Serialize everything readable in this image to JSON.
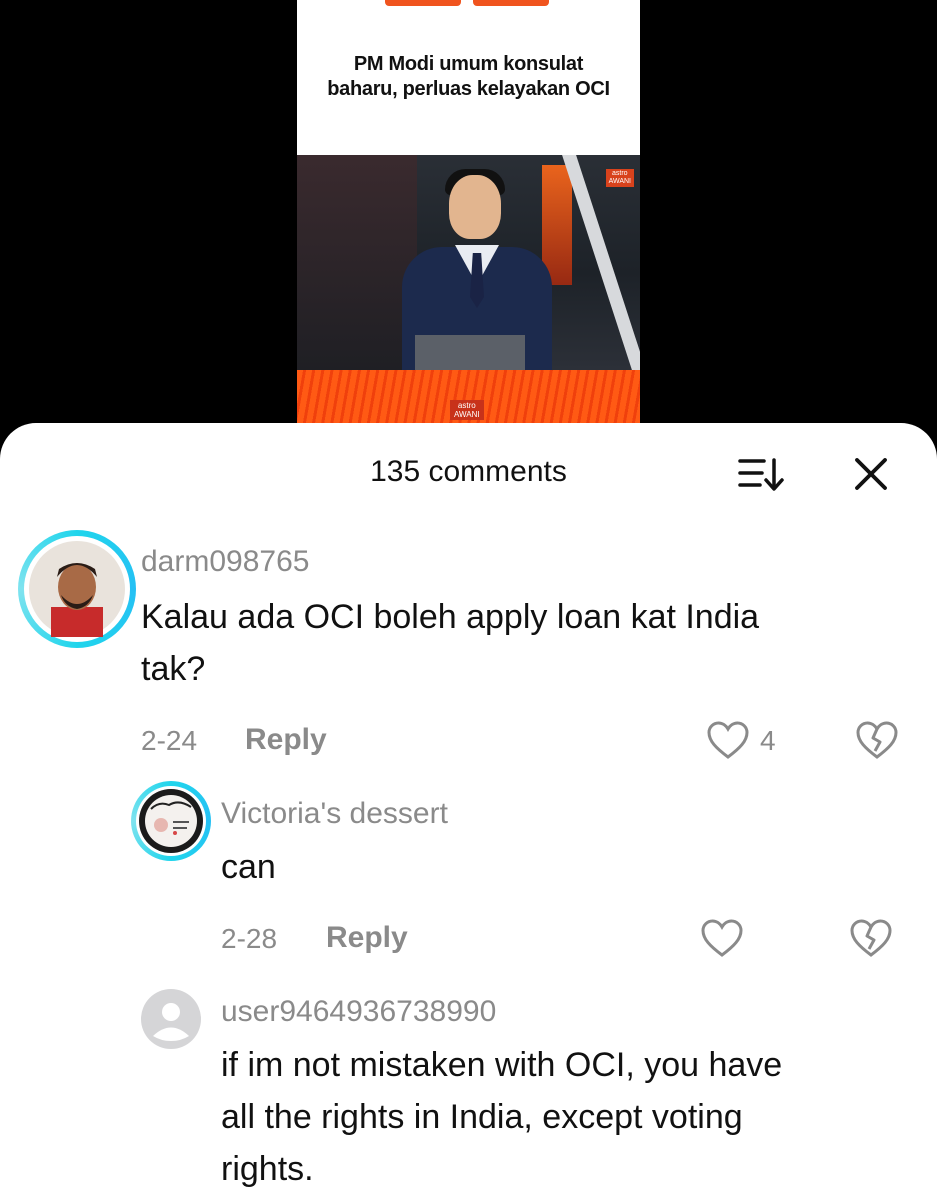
{
  "video": {
    "headline_line1": "PM Modi umum konsulat",
    "headline_line2": "baharu, perluas kelayakan OCI",
    "logo_top": "astro",
    "logo_bottom": "AWANI"
  },
  "comments_panel": {
    "title": "135 comments",
    "icons": {
      "sort": "sort-icon",
      "close": "close-icon"
    },
    "comments": [
      {
        "username": "darm098765",
        "text_line1": "Kalau ada OCI boleh apply loan kat India",
        "text_line2": "tak?",
        "date": "2-24",
        "reply_label": "Reply",
        "likes": "4"
      },
      {
        "username": "Victoria's dessert",
        "text_line1": "can",
        "date": "2-28",
        "reply_label": "Reply",
        "likes": ""
      },
      {
        "username": "user9464936738990",
        "text_line1": "if im not mistaken with OCI, you have",
        "text_line2": "all the rights in India, except voting",
        "text_line3": "rights."
      }
    ]
  },
  "colors": {
    "accent": "#f0541e",
    "ring": "#20d5ec",
    "muted": "#8a8a8a"
  }
}
